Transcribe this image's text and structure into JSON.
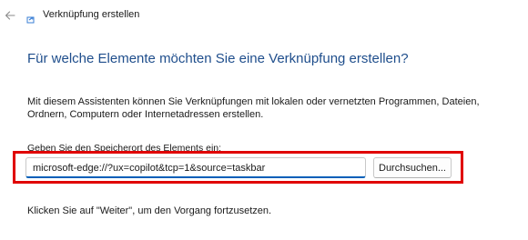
{
  "window": {
    "title": "Verknüpfung erstellen",
    "back_icon": "arrow-left-icon",
    "app_icon": "shortcut-app-icon"
  },
  "main": {
    "heading": "Für welche Elemente möchten Sie eine Verknüpfung erstellen?",
    "description": "Mit diesem Assistenten können Sie Verknüpfungen mit lokalen oder vernetzten Programmen, Dateien, Ordnern, Computern oder Internetadressen erstellen.",
    "location_label": "Geben Sie den Speicherort des Elements ein:",
    "location_value": "microsoft-edge://?ux=copilot&tcp=1&source=taskbar",
    "browse_label": "Durchsuchen...",
    "hint": "Klicken Sie auf \"Weiter\", um den Vorgang fortzusetzen."
  },
  "colors": {
    "heading": "#1f4e8c",
    "highlight": "#e00000",
    "input_focus": "#005fb8"
  }
}
